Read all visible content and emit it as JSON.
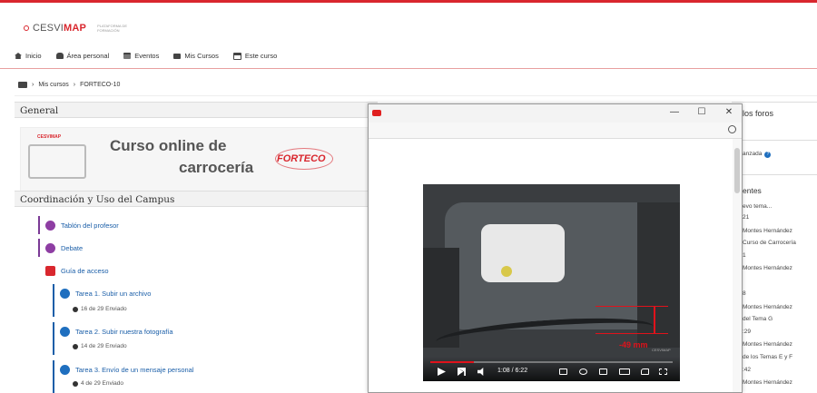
{
  "brand": {
    "name_prefix": "CESVI",
    "name_suffix": "MAP",
    "tagline": "Plataforma de Formación"
  },
  "nav": [
    {
      "label": "Inicio",
      "icon": "home-icon"
    },
    {
      "label": "Área personal",
      "icon": "car-icon"
    },
    {
      "label": "Eventos",
      "icon": "calendar-icon"
    },
    {
      "label": "Mis Cursos",
      "icon": "briefcase-icon"
    },
    {
      "label": "Este curso",
      "icon": "sitemap-icon"
    }
  ],
  "breadcrumb": {
    "sep": "›",
    "items": [
      "Mis cursos",
      "FORTECO-10"
    ]
  },
  "sections": {
    "general": "General",
    "coordination": "Coordinación y Uso del Campus"
  },
  "banner": {
    "line1": "Curso online de",
    "line2": "carrocería",
    "partner": "FORTECO",
    "mark": "CESVIMAP"
  },
  "activities": [
    {
      "label": "Tablón del profesor",
      "type": "forum"
    },
    {
      "label": "Debate",
      "type": "forum"
    },
    {
      "label": "Guía de acceso",
      "type": "pdf"
    },
    {
      "label": "Tarea 1. Subir un archivo",
      "type": "assignment",
      "status": "16 de 29 Enviado"
    },
    {
      "label": "Tarea 2. Subir nuestra fotografía",
      "type": "assignment",
      "status": "14 de 29 Enviado"
    },
    {
      "label": "Tarea 3. Envío de un mensaje personal",
      "type": "assignment",
      "status": "4 de 29 Enviado"
    }
  ],
  "right_panel": {
    "title_fragment": "los foros",
    "search_fragment": "anzada",
    "help_mark": "?",
    "recent_header_fragment": "entes",
    "entries": [
      "evo tema...",
      "21",
      "Montes Hernández",
      "Curso de Carrocería",
      "1",
      "Montes Hernández",
      "8",
      "Montes Hernández",
      "del Tema G",
      ":29",
      "Montes Hernández",
      "de los Temas E y F",
      ":42",
      "Montes Hernández"
    ]
  },
  "popup": {
    "window_controls": {
      "minimize": "—",
      "maximize": "☐",
      "close": "✕"
    },
    "video": {
      "current_time": "1:08",
      "separator": " / ",
      "duration": "6:22",
      "measurement": "-49 mm",
      "watermark": "CESVIMAP",
      "progress": 0.178
    }
  }
}
